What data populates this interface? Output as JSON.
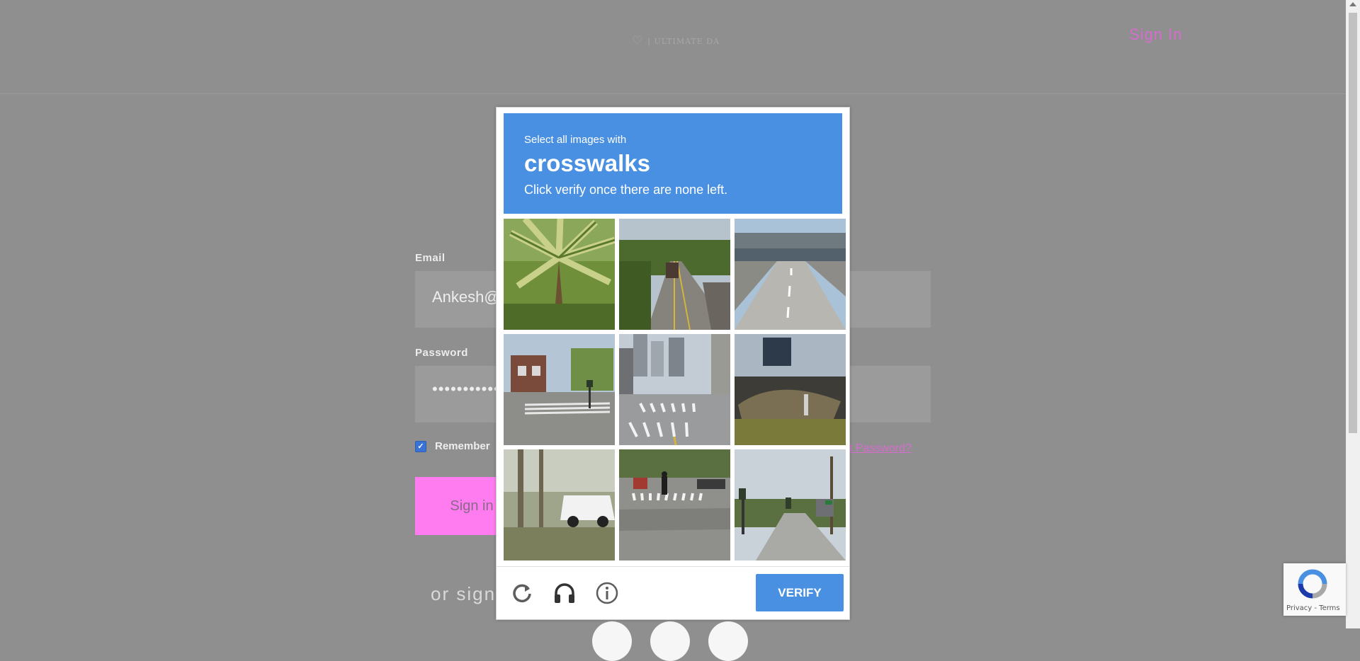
{
  "page": {
    "logo_text": "| ULTIMATE DA",
    "signin_link": "Sign In",
    "email_label": "Email",
    "email_value": "Ankesh@g",
    "password_label": "Password",
    "password_value": "••••••••••••",
    "remember_label": "Remember",
    "remember_checked": true,
    "forgot_label": "ot Password?",
    "signin_button": "Sign in",
    "or_sign": "or sign"
  },
  "captcha": {
    "prompt": "Select all images with",
    "target": "crosswalks",
    "instruction": "Click verify once there are none left.",
    "tiles": [
      {
        "scene": "palm-tree"
      },
      {
        "scene": "truck-on-bridge-road"
      },
      {
        "scene": "empty-highway"
      },
      {
        "scene": "street-with-houses-crosswalk"
      },
      {
        "scene": "city-street-crosswalk"
      },
      {
        "scene": "boat-in-yard"
      },
      {
        "scene": "white-truck-behind-trees"
      },
      {
        "scene": "pedestrian-on-crosswalk"
      },
      {
        "scene": "street-with-traffic-light"
      }
    ],
    "verify_button": "VERIFY",
    "icons": [
      "reload-icon",
      "audio-icon",
      "info-icon"
    ]
  },
  "badge": {
    "terms": "Privacy - Terms"
  },
  "colors": {
    "accent": "#4a90e2",
    "brand_pink": "#ff7cf0",
    "link_pink": "#d76ccf",
    "overlay": "#8f8f8f"
  }
}
